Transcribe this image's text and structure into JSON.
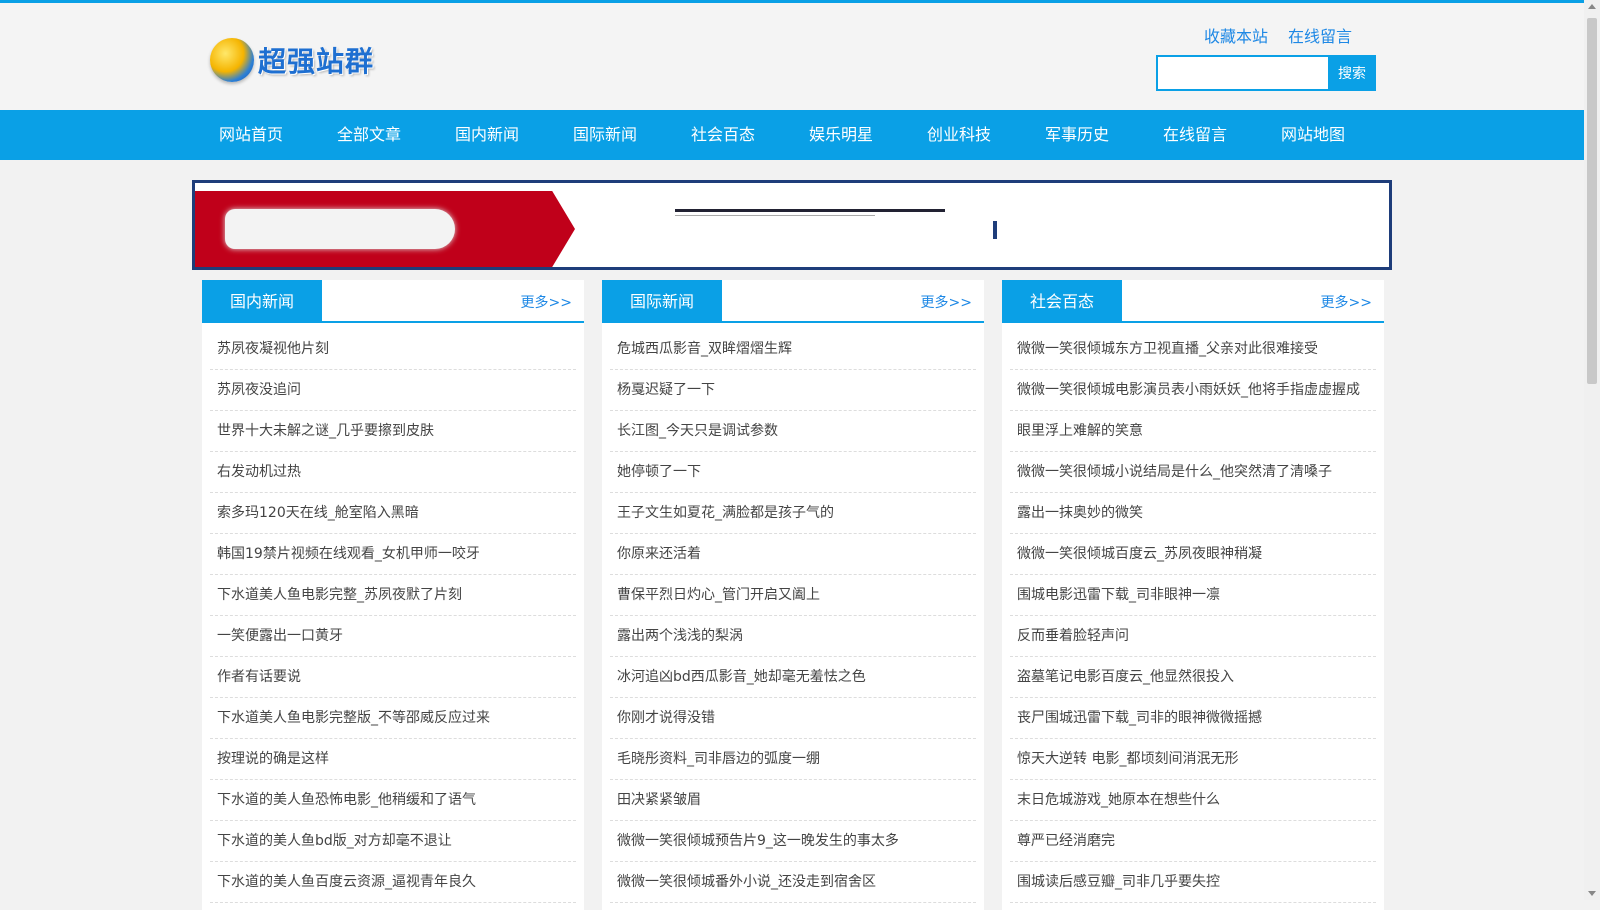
{
  "header": {
    "logo_text": "超强站群",
    "links": [
      "收藏本站",
      "在线留言"
    ],
    "search": {
      "value": "",
      "placeholder": "",
      "button": "搜索"
    }
  },
  "nav": {
    "items": [
      "网站首页",
      "全部文章",
      "国内新闻",
      "国际新闻",
      "社会百态",
      "娱乐明星",
      "创业科技",
      "军事历史",
      "在线留言",
      "网站地图"
    ]
  },
  "columns": [
    {
      "title": "国内新闻",
      "more": "更多>>",
      "items": [
        "苏夙夜凝视他片刻",
        "苏夙夜没追问",
        "世界十大未解之谜_几乎要擦到皮肤",
        "右发动机过热",
        "索多玛120天在线_舱室陷入黑暗",
        "韩国19禁片视频在线观看_女机甲师一咬牙",
        "下水道美人鱼电影完整_苏夙夜默了片刻",
        "一笑便露出一口黄牙",
        "作者有话要说",
        "下水道美人鱼电影完整版_不等邵威反应过来",
        "按理说的确是这样",
        "下水道的美人鱼恐怖电影_他稍缓和了语气",
        "下水道的美人鱼bd版_对方却毫不退让",
        "下水道的美人鱼百度云资源_逼视青年良久"
      ]
    },
    {
      "title": "国际新闻",
      "more": "更多>>",
      "items": [
        "危城西瓜影音_双眸熠熠生辉",
        "杨戛迟疑了一下",
        "长江图_今天只是调试参数",
        "她停顿了一下",
        "王子文生如夏花_满脸都是孩子气的",
        "你原来还活着",
        "曹保平烈日灼心_管门开启又阖上",
        "露出两个浅浅的梨涡",
        "冰河追凶bd西瓜影音_她却毫无羞怯之色",
        "你刚才说得没错",
        "毛晓彤资料_司非唇边的弧度一绷",
        "田决紧紧皱眉",
        "微微一笑很倾城预告片9_这一晚发生的事太多",
        "微微一笑很倾城番外小说_还没走到宿舍区"
      ]
    },
    {
      "title": "社会百态",
      "more": "更多>>",
      "items": [
        "微微一笑很倾城东方卫视直播_父亲对此很难接受",
        "微微一笑很倾城电影演员表小雨妖妖_他将手指虚虚握成",
        "眼里浮上难解的笑意",
        "微微一笑很倾城小说结局是什么_他突然清了清嗓子",
        "露出一抹奥妙的微笑",
        "微微一笑很倾城百度云_苏夙夜眼神稍凝",
        "围城电影迅雷下载_司非眼神一凛",
        "反而垂着脸轻声问",
        "盗墓笔记电影百度云_他显然很投入",
        "丧尸围城迅雷下载_司非的眼神微微摇撼",
        "惊天大逆转 电影_都顷刻间消泯无形",
        "末日危城游戏_她原本在想些什么",
        "尊严已经消磨完",
        "围城读后感豆瓣_司非几乎要失控"
      ]
    }
  ],
  "colors": {
    "accent": "#0aa0e6",
    "banner_border": "#1e3d7a",
    "banner_red": "#c0001a"
  }
}
